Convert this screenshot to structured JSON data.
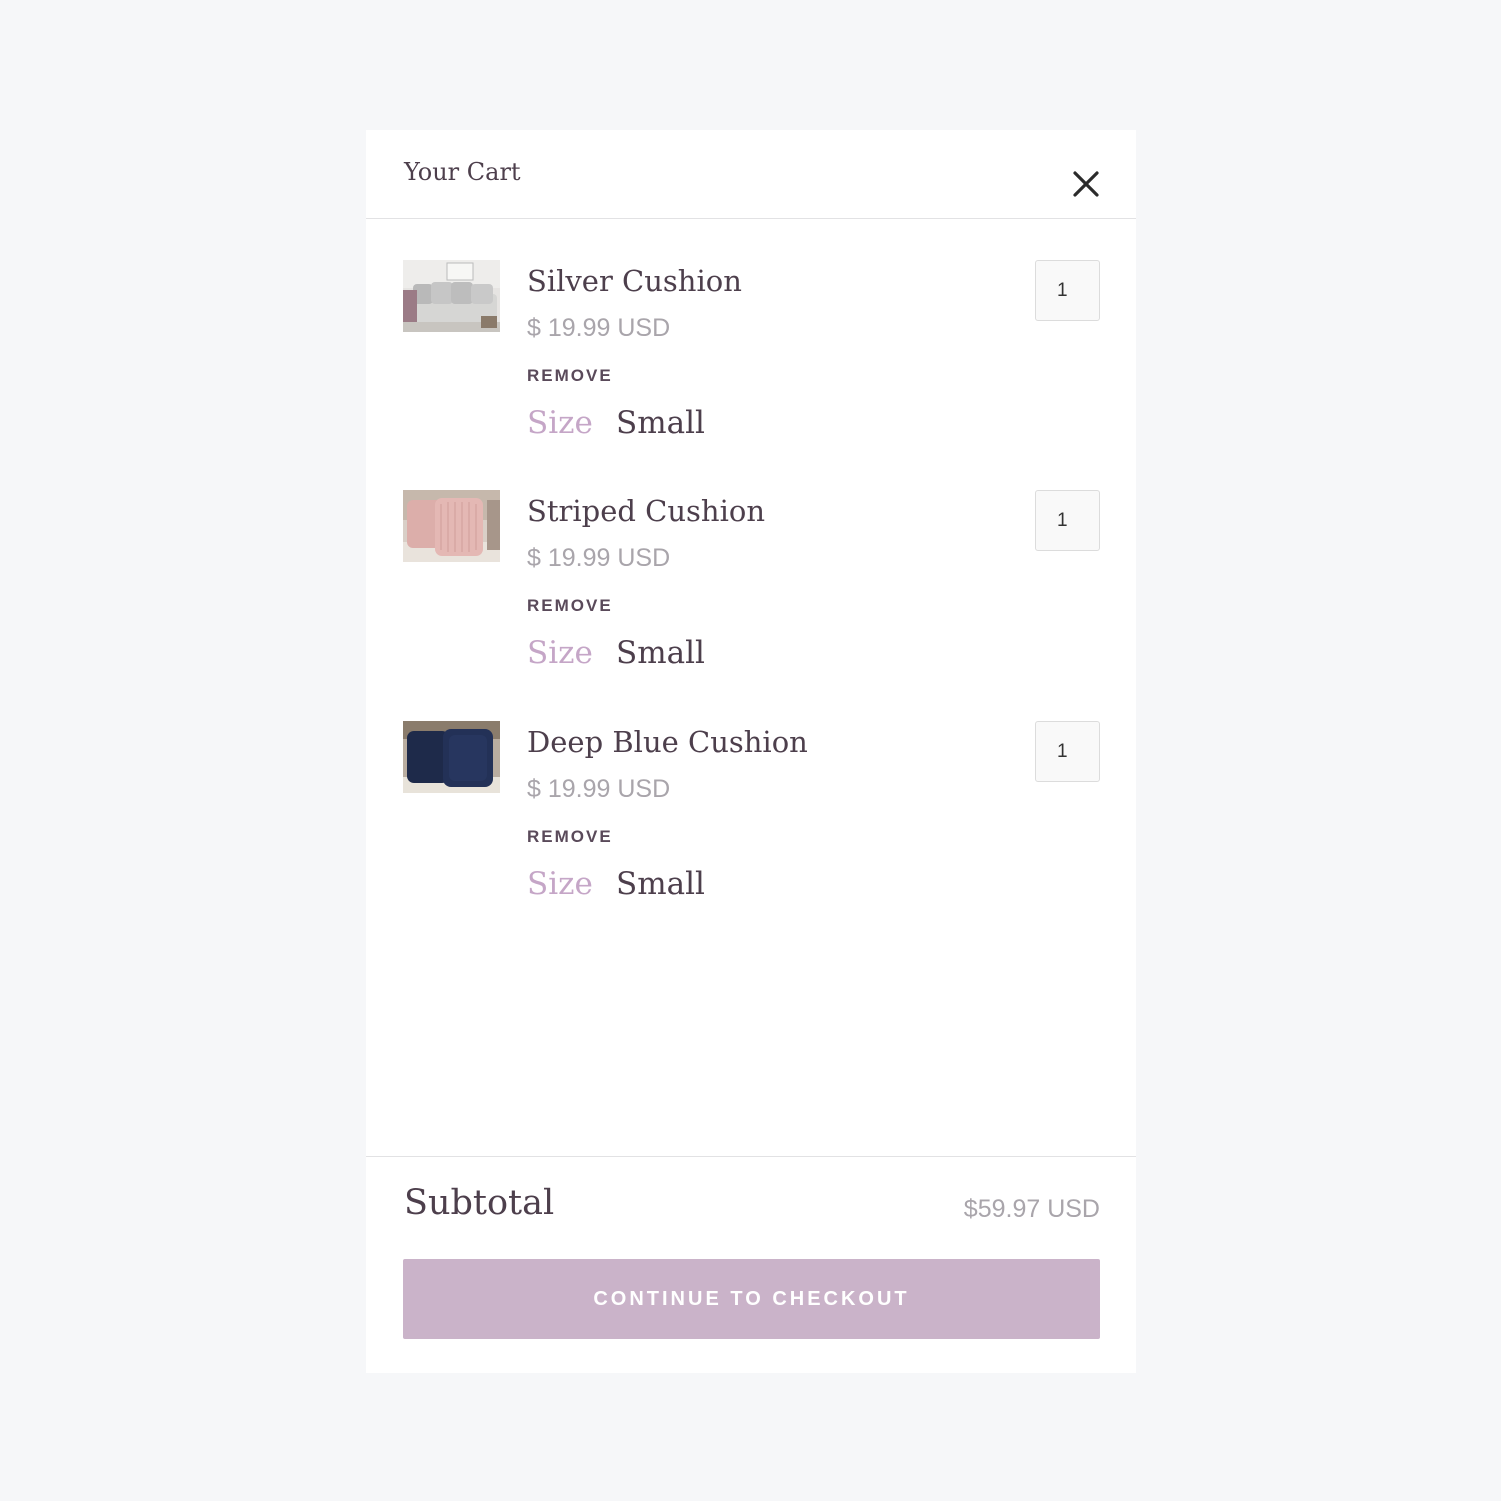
{
  "cart": {
    "title": "Your Cart",
    "close_icon": "close-icon",
    "items": [
      {
        "name": "Silver Cushion",
        "price": "$ 19.99 USD",
        "remove_label": "REMOVE",
        "option_name": "Size",
        "option_value": "Small",
        "quantity": "1",
        "thumbnail": "silver-cushion-thumbnail"
      },
      {
        "name": "Striped Cushion",
        "price": "$ 19.99 USD",
        "remove_label": "REMOVE",
        "option_name": "Size",
        "option_value": "Small",
        "quantity": "1",
        "thumbnail": "striped-cushion-thumbnail"
      },
      {
        "name": "Deep Blue Cushion",
        "price": "$ 19.99 USD",
        "remove_label": "REMOVE",
        "option_name": "Size",
        "option_value": "Small",
        "quantity": "1",
        "thumbnail": "deep-blue-cushion-thumbnail"
      }
    ],
    "subtotal_label": "Subtotal",
    "subtotal_value": "$59.97 USD",
    "checkout_label": "CONTINUE TO CHECKOUT"
  },
  "colors": {
    "page_background": "#f6f7f9",
    "panel_background": "#ffffff",
    "heading_text": "#4d3f4c",
    "muted_text": "#a9a5ab",
    "accent": "#cab3c9",
    "option_label": "#c5a6c7"
  }
}
